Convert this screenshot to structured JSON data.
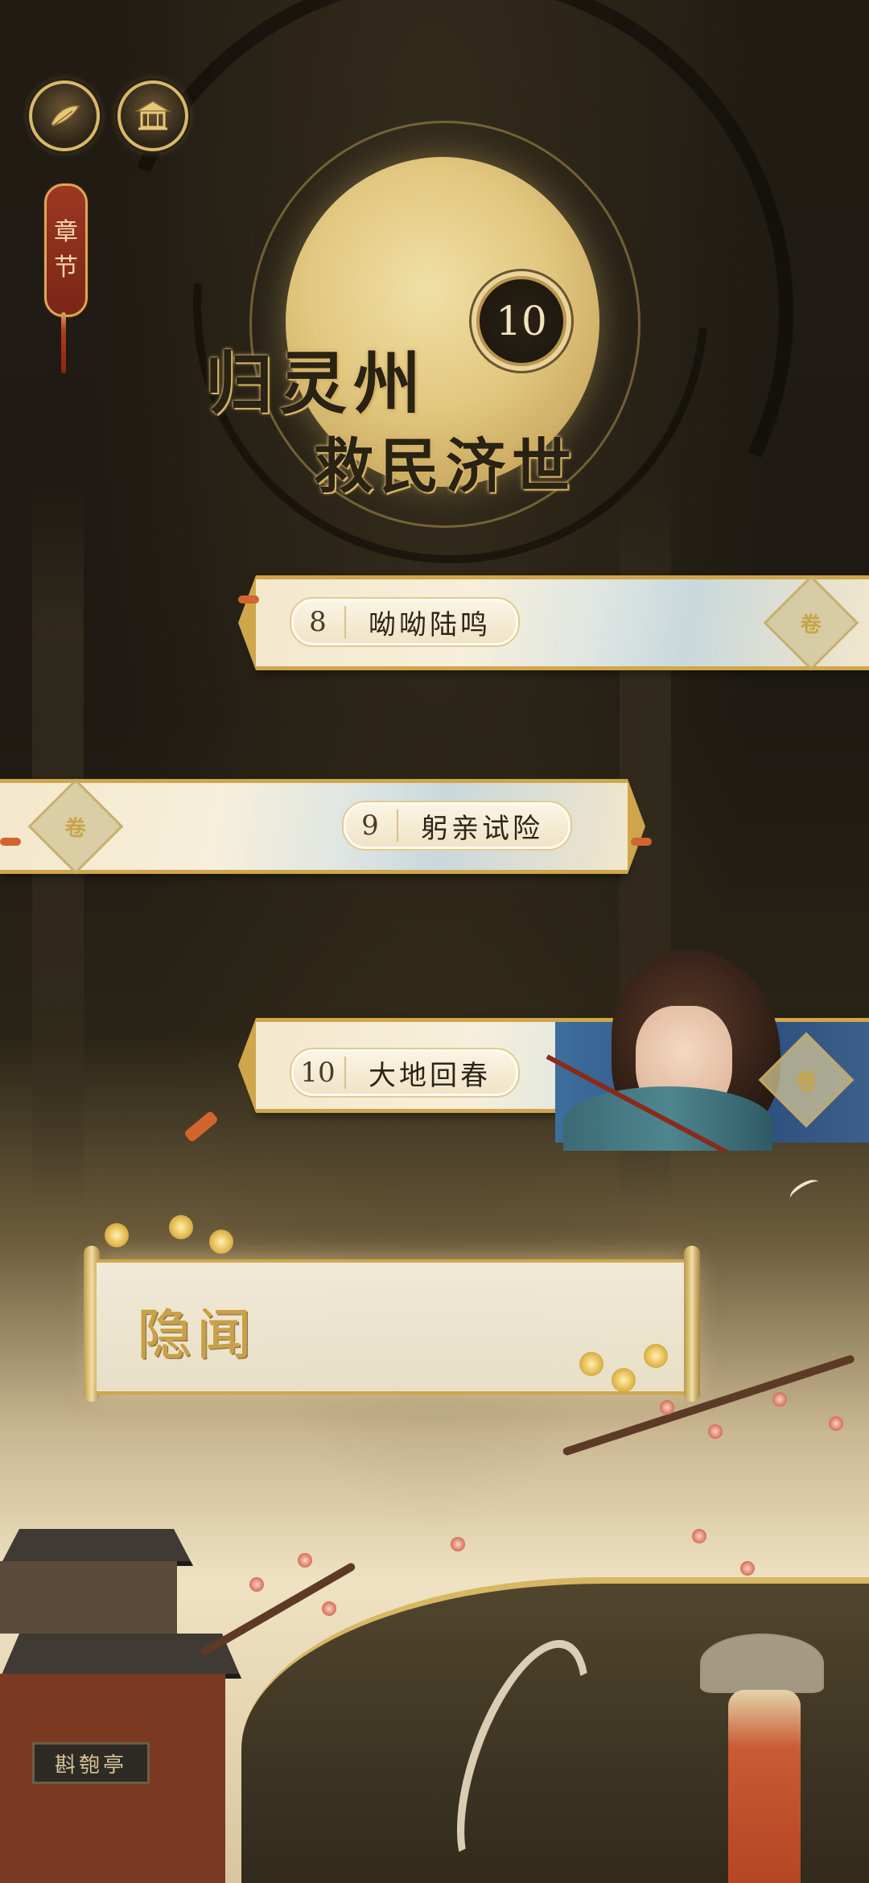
{
  "header": {
    "left_icon": "feather-icon",
    "right_icon": "pavilion-icon",
    "chapter_tag": [
      "章",
      "节"
    ]
  },
  "hero": {
    "chapter_number": "10",
    "title_line1": "归灵州",
    "title_line2": "救民济世"
  },
  "chapters": [
    {
      "number": "8",
      "name": "呦呦陆鸣"
    },
    {
      "number": "9",
      "name": "躬亲试险"
    },
    {
      "number": "10",
      "name": "大地回春"
    }
  ],
  "side_story": {
    "title": "隐闻"
  },
  "scenery": {
    "sign_text": "斟匏亭"
  },
  "colors": {
    "gold": "#cfa64c",
    "dark_bg": "#1f1a12",
    "card_light": "#f3e8cc",
    "accent_red": "#9c3822"
  }
}
